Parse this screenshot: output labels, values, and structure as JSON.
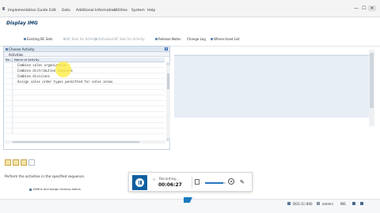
{
  "menubar": {
    "items": [
      {
        "label": "Implementation Guide"
      },
      {
        "label": "Edit"
      },
      {
        "label": "Goto"
      },
      {
        "label": "Additional Information"
      },
      {
        "label": "Utilities"
      },
      {
        "label": "System"
      },
      {
        "label": "Help"
      }
    ]
  },
  "window": {
    "minimize": "—",
    "maximize": "☐",
    "close": "✕"
  },
  "page": {
    "title": "Display IMG"
  },
  "toolbar": {
    "buttons": [
      {
        "label": "Existing BC Sets"
      },
      {
        "label": "BC Sets for Activity"
      },
      {
        "label": "Activated BC Sets for Activity"
      },
      {
        "label": "Release Notes"
      },
      {
        "label": "Change Log"
      },
      {
        "label": "Where-Used List"
      }
    ]
  },
  "dialog": {
    "title": "Choose Activity",
    "close": "×",
    "tab": "Activities",
    "columns": {
      "re": "Re...",
      "name": "Name of Activity"
    },
    "activities": [
      "Combine sales organization",
      "Combine distribution channels",
      "Combine divisions",
      "Assign sales order types permitted for sales areas"
    ],
    "hint": "Perform the activities in the specified sequence."
  },
  "background": {
    "row": "Define and assign cleanup status"
  },
  "recorder": {
    "label": "Recording...",
    "time": "00:06:27",
    "volume_fraction": 0.9
  },
  "status": {
    "system": "DGS (1) 800",
    "user": "ommrs",
    "mode": "INS"
  },
  "colors": {
    "accent": "#0a3b66",
    "panel": "#e7eef6",
    "recorder_button": "#0f5f9f",
    "highlight": "#ffec40"
  }
}
